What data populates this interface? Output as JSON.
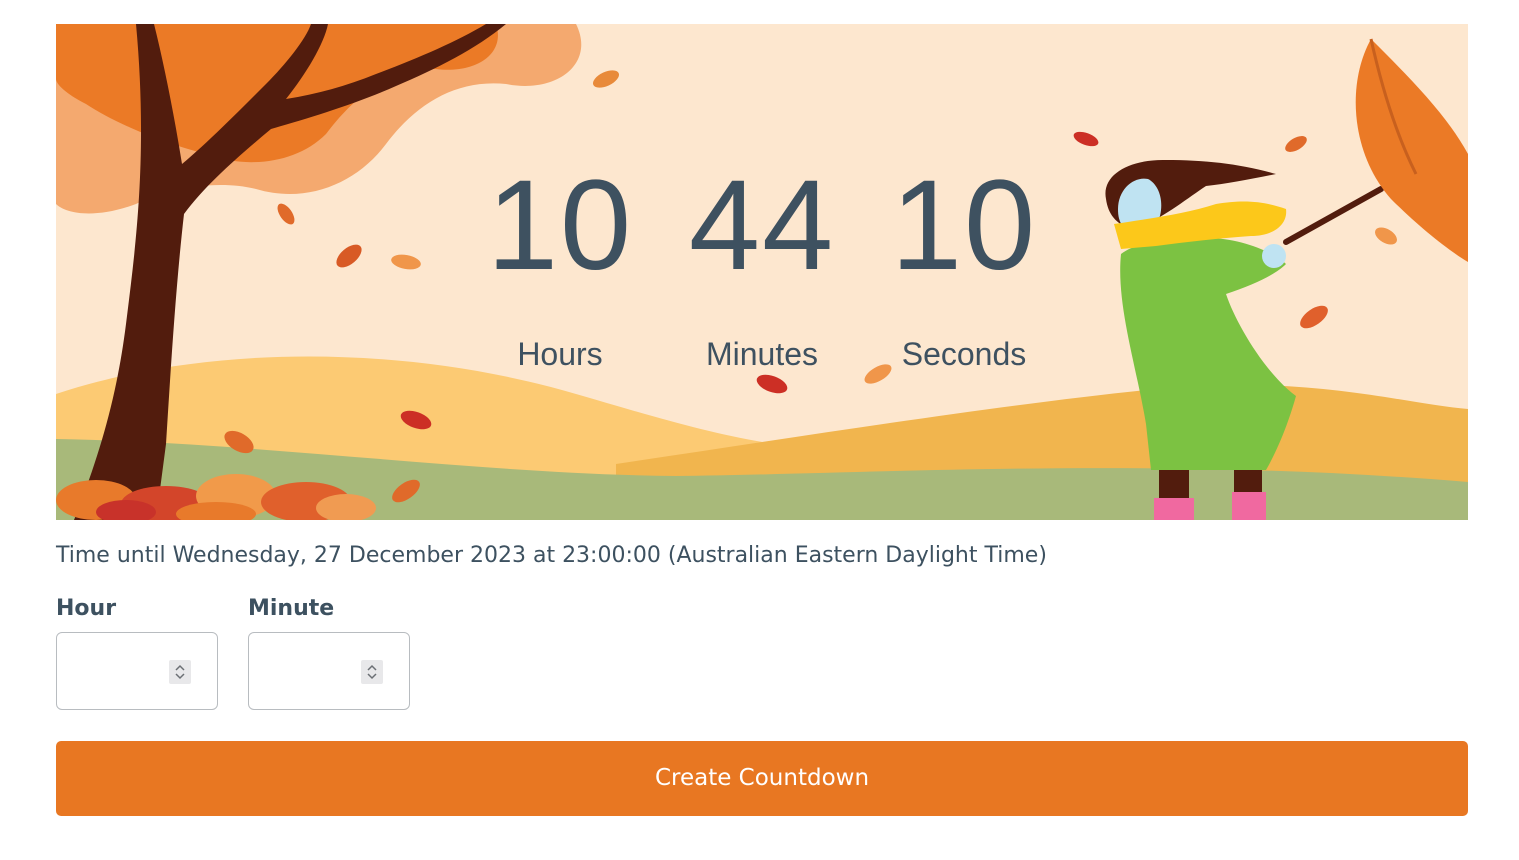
{
  "countdown": {
    "hours": {
      "value": "10",
      "label": "Hours"
    },
    "minutes": {
      "value": "44",
      "label": "Minutes"
    },
    "seconds": {
      "value": "10",
      "label": "Seconds"
    }
  },
  "target_text": "Time until Wednesday, 27 December 2023 at 23:00:00 (Australian Eastern Daylight Time)",
  "form": {
    "hour": {
      "label": "Hour",
      "value": ""
    },
    "minute": {
      "label": "Minute",
      "value": ""
    },
    "submit_label": "Create Countdown"
  },
  "colors": {
    "sky": "#fde7cf",
    "accent": "#e87722",
    "text": "#3d5160",
    "grass": "#a8b97a"
  }
}
